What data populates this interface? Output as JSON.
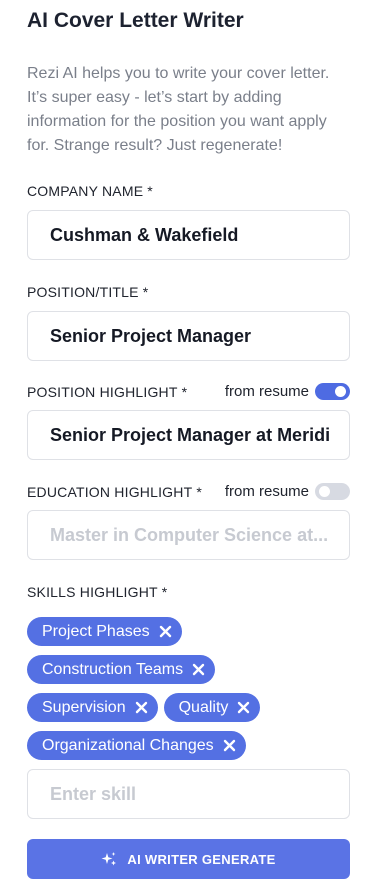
{
  "header": {
    "title": "AI Cover Letter Writer",
    "description": "Rezi AI helps you to write your cover letter. It’s super easy - let’s start by adding information for the position you want apply for. Strange result? Just regenerate!"
  },
  "fields": {
    "company": {
      "label": "COMPANY NAME",
      "required": "*",
      "value": "Cushman & Wakefield"
    },
    "position": {
      "label": "POSITION/TITLE",
      "required": "*",
      "value": "Senior Project Manager"
    },
    "position_highlight": {
      "label": "POSITION HIGHLIGHT",
      "required": "*",
      "toggle_label": "from resume",
      "toggle_on": true,
      "value": "Senior Project Manager at Meridi"
    },
    "education_highlight": {
      "label": "EDUCATION HIGHLIGHT",
      "required": "*",
      "toggle_label": "from resume",
      "toggle_on": false,
      "placeholder": "Master in Computer Science at..."
    },
    "skills": {
      "label": "SKILLS HIGHLIGHT",
      "required": "*",
      "tags": [
        "Project Phases",
        "Construction Teams",
        "Supervision",
        "Quality",
        "Organizational Changes"
      ],
      "placeholder": "Enter skill"
    }
  },
  "generate_button": {
    "label": "AI WRITER GENERATE",
    "icon": "sparkle-icon"
  },
  "colors": {
    "accent": "#5470e3",
    "toggle_off": "#d7dae2",
    "border": "#dfe1e6",
    "muted_text": "#7a7f8a"
  }
}
